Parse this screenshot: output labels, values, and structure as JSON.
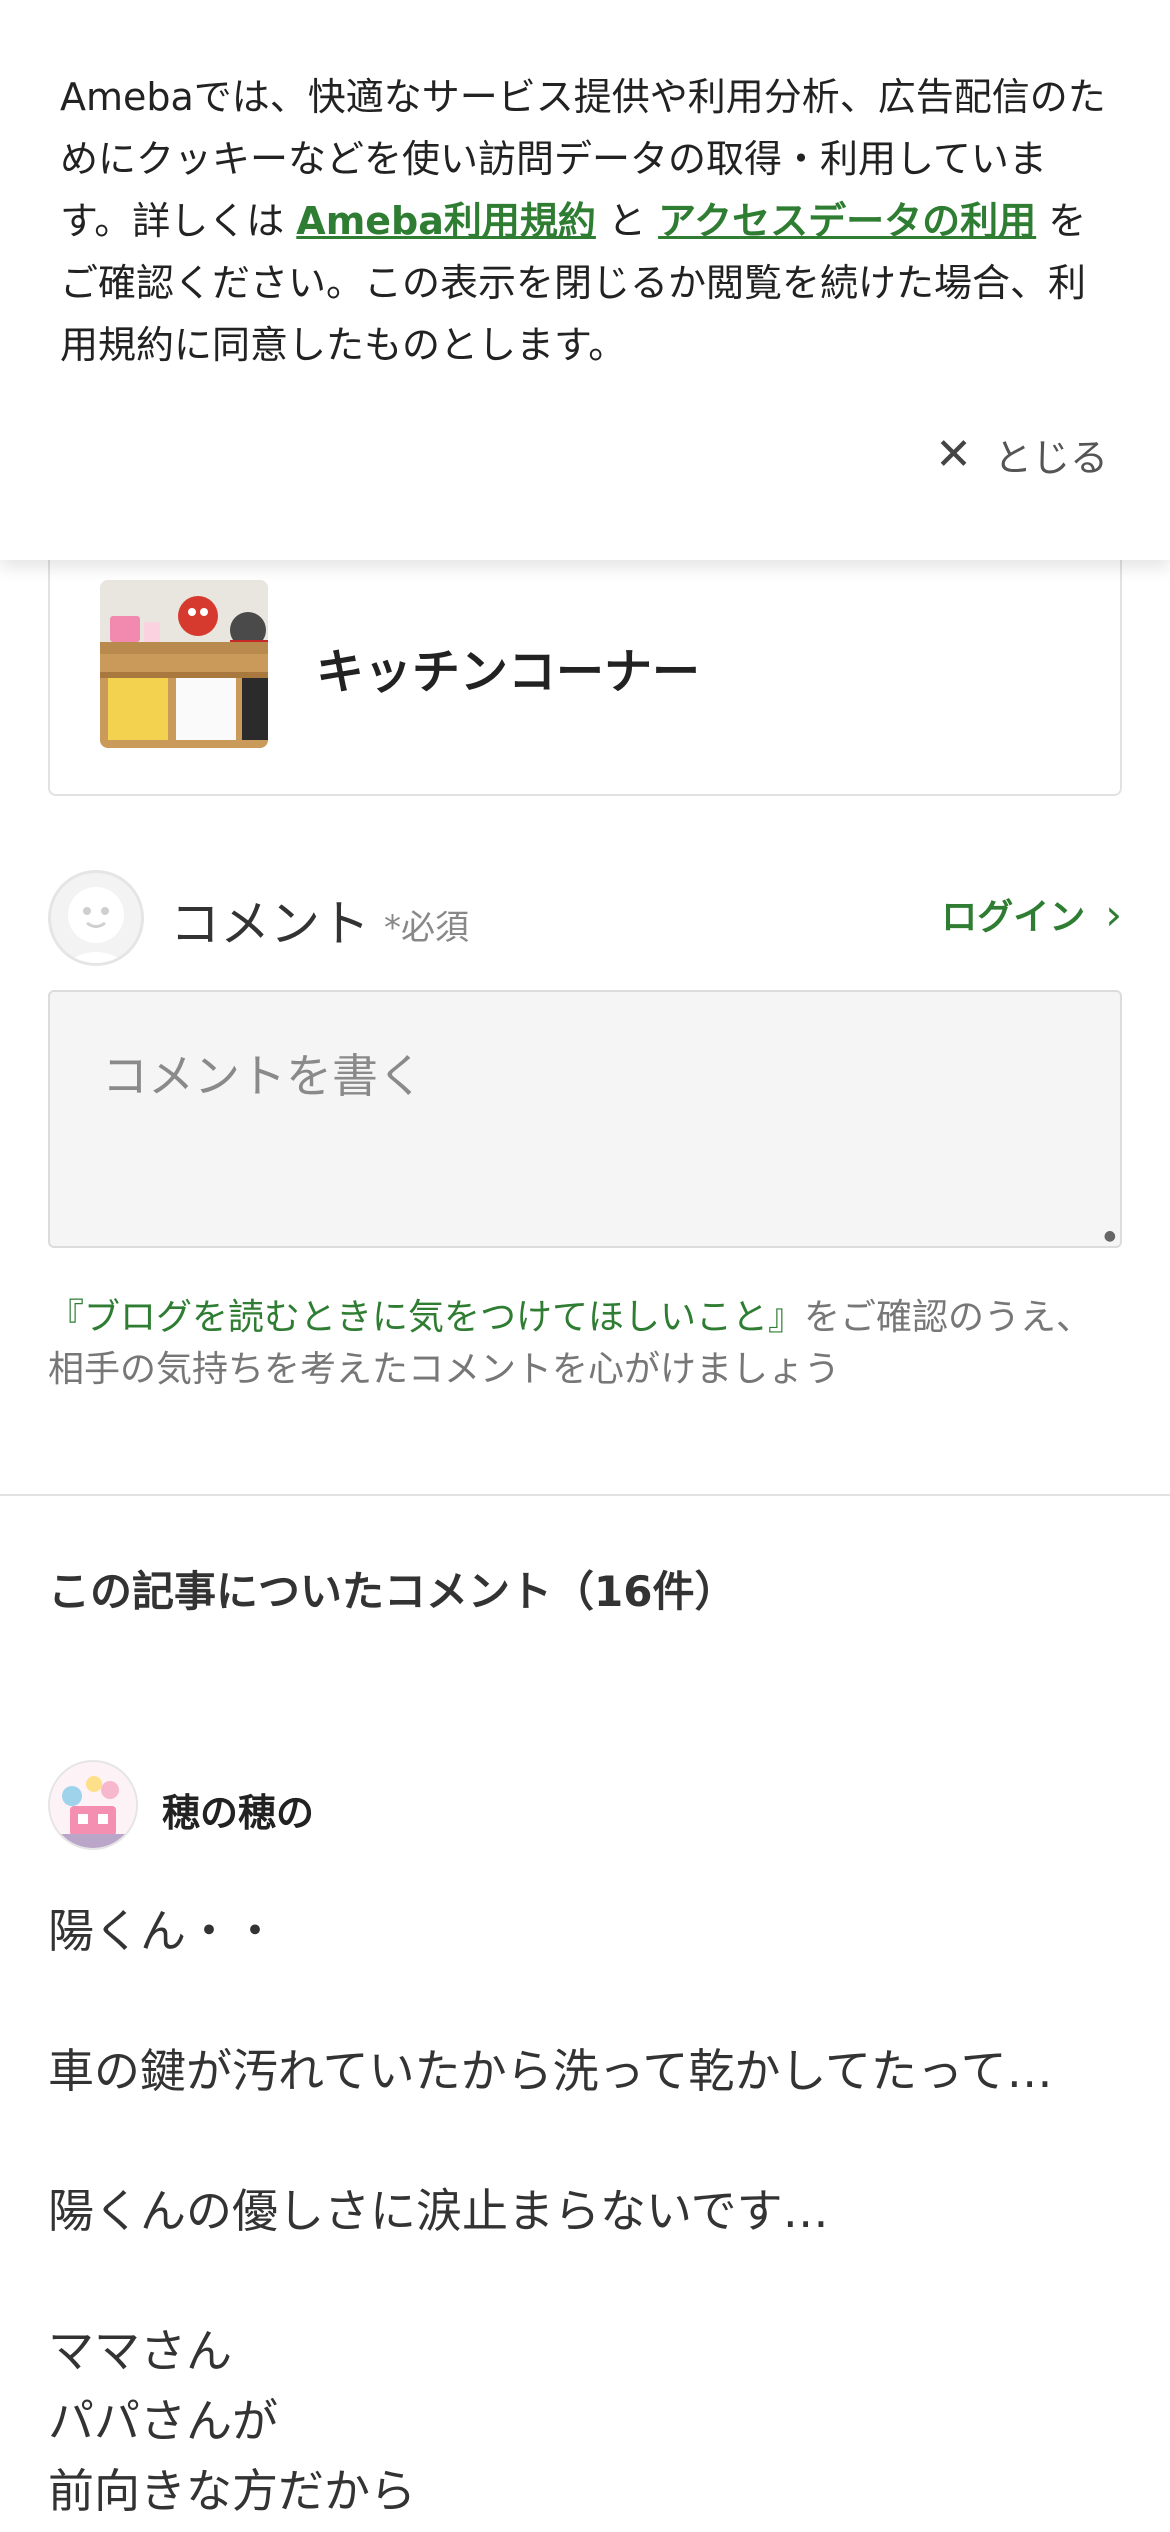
{
  "cookie_banner": {
    "text_before": "Amebaでは、快適なサービス提供や利用分析、広告配信のためにクッキーなどを使い訪問データの取得・利用しています。詳しくは ",
    "terms_link": "Ameba利用規約",
    "text_and": " と ",
    "access_link": "アクセスデータの利用",
    "text_after": " をご確認ください。この表示を閉じるか閲覧を続けた場合、利用規約に同意したものとします。",
    "close_label": "とじる"
  },
  "entry_card": {
    "title": "キッチンコーナー"
  },
  "comment_form": {
    "label": "コメント",
    "required": "*必須",
    "login_label": "ログイン",
    "placeholder": "コメントを書く",
    "guideline_link": "『ブログを読むときに気をつけてほしいこと』",
    "guideline_text": "をご確認のうえ、相手の気持ちを考えたコメントを心がけましょう"
  },
  "comments_section": {
    "title": "この記事についたコメント（16件）"
  },
  "comment": {
    "user_name": "穂の穂の",
    "lines": [
      "陽くん・・",
      "",
      "車の鍵が汚れていたから洗って乾かしてたって…",
      "",
      "陽くんの優しさに涙止まらないです…",
      "",
      "ママさん",
      "パパさんが",
      "前向きな方だから"
    ]
  },
  "colors": {
    "accent_green": "#2e7d32",
    "text": "#333333",
    "muted": "#888888"
  }
}
